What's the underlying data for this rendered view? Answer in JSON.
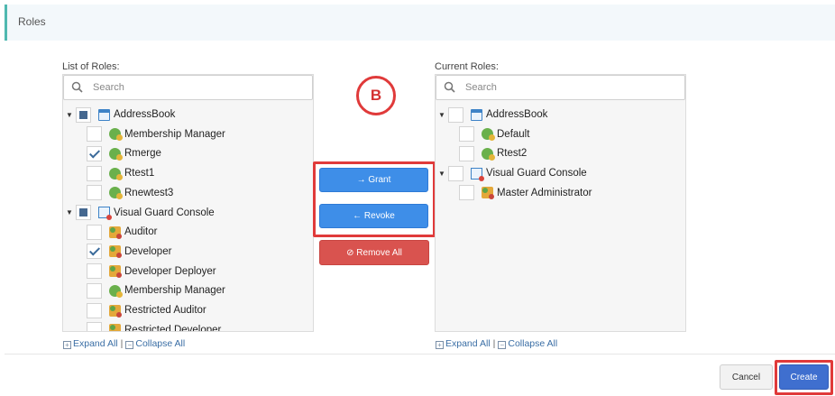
{
  "header": {
    "title": "Roles"
  },
  "left_panel": {
    "label": "List of Roles:",
    "search_placeholder": "Search",
    "tree": [
      {
        "label": "AddressBook",
        "level": 0,
        "state": "partial",
        "icon": "application-icon",
        "caret": "▼"
      },
      {
        "label": "Membership Manager",
        "level": 1,
        "state": "unchecked",
        "icon": "role-icon"
      },
      {
        "label": "Rmerge",
        "level": 1,
        "state": "checked",
        "icon": "role-icon"
      },
      {
        "label": "Rtest1",
        "level": 1,
        "state": "unchecked",
        "icon": "role-icon"
      },
      {
        "label": "Rnewtest3",
        "level": 1,
        "state": "unchecked",
        "icon": "role-icon"
      },
      {
        "label": "Visual Guard Console",
        "level": 0,
        "state": "partial",
        "icon": "console-icon",
        "caret": "▼"
      },
      {
        "label": "Auditor",
        "level": 1,
        "state": "unchecked",
        "icon": "admin-role-icon"
      },
      {
        "label": "Developer",
        "level": 1,
        "state": "checked",
        "icon": "admin-role-icon"
      },
      {
        "label": "Developer Deployer",
        "level": 1,
        "state": "unchecked",
        "icon": "admin-role-icon"
      },
      {
        "label": "Membership Manager",
        "level": 1,
        "state": "unchecked",
        "icon": "role-icon"
      },
      {
        "label": "Restricted Auditor",
        "level": 1,
        "state": "unchecked",
        "icon": "admin-role-icon"
      },
      {
        "label": "Restricted Developer",
        "level": 1,
        "state": "unchecked",
        "icon": "admin-role-icon"
      }
    ],
    "expand_all": "Expand All",
    "collapse_all": "Collapse All",
    "separator": "|"
  },
  "right_panel": {
    "label": "Current Roles:",
    "search_placeholder": "Search",
    "tree": [
      {
        "label": "AddressBook",
        "level": 0,
        "state": "unchecked",
        "icon": "application-icon",
        "caret": "▼"
      },
      {
        "label": "Default",
        "level": 1,
        "state": "unchecked",
        "icon": "role-icon"
      },
      {
        "label": "Rtest2",
        "level": 1,
        "state": "unchecked",
        "icon": "role-icon"
      },
      {
        "label": "Visual Guard Console",
        "level": 0,
        "state": "unchecked",
        "icon": "console-icon",
        "caret": "▼"
      },
      {
        "label": "Master Administrator",
        "level": 1,
        "state": "unchecked",
        "icon": "admin-role-icon"
      }
    ],
    "expand_all": "Expand All",
    "collapse_all": "Collapse All",
    "separator": "|"
  },
  "actions": {
    "annotation": "B",
    "grant": "→ Grant",
    "revoke": "← Revoke",
    "remove_all": "⊘ Remove All"
  },
  "footer": {
    "cancel": "Cancel",
    "create": "Create"
  },
  "colors": {
    "primary": "#3e8ee8",
    "danger": "#d9534f",
    "highlight": "#e03a3a",
    "create": "#3f6fcf"
  }
}
